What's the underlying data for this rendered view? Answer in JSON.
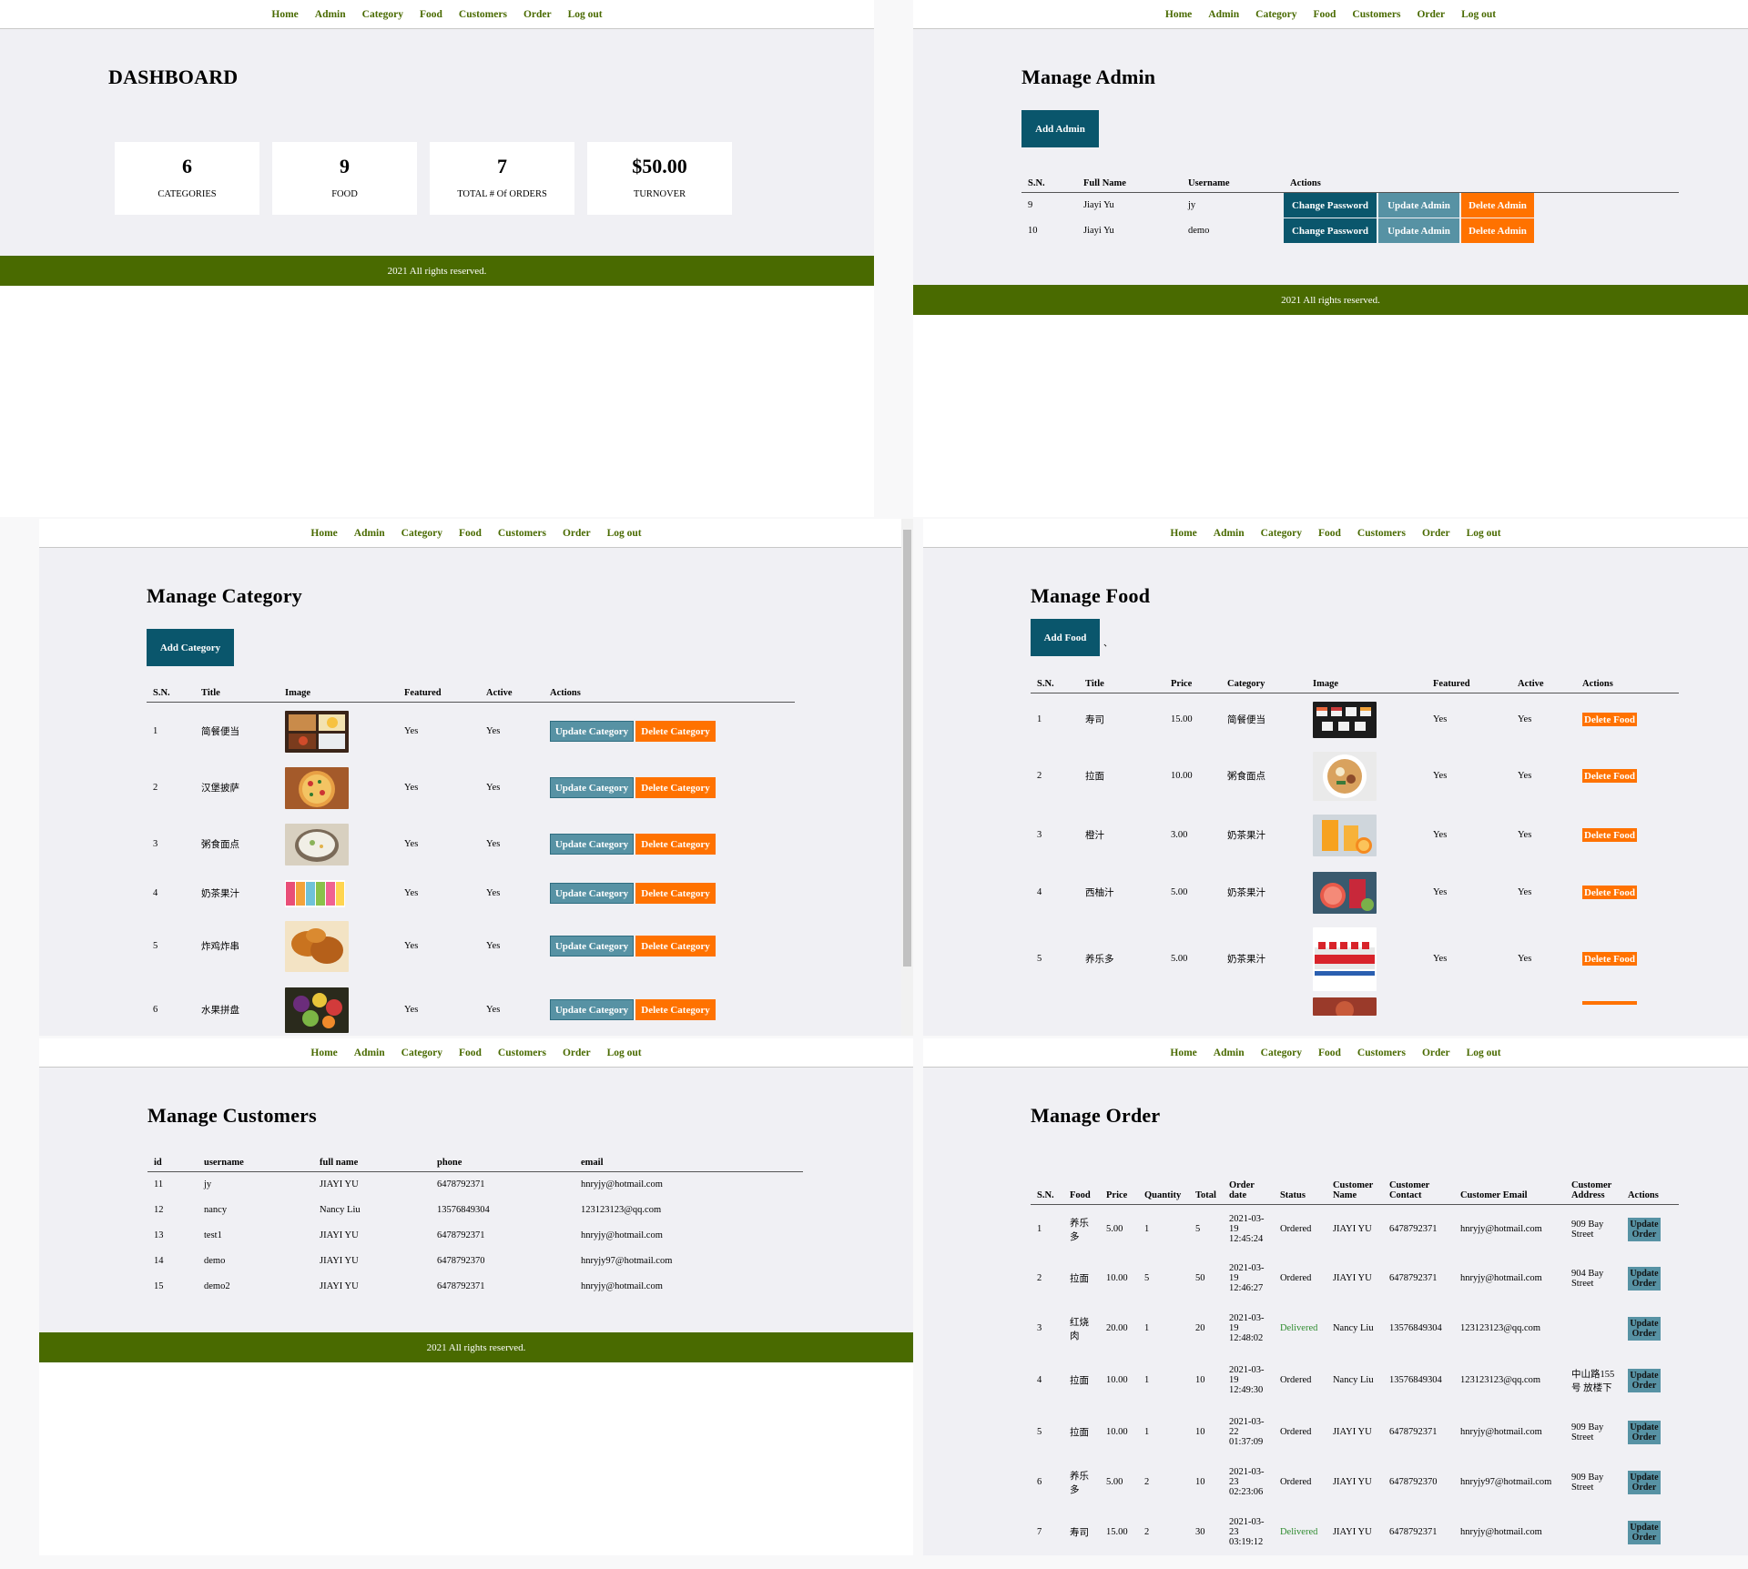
{
  "nav": [
    "Home",
    "Admin",
    "Category",
    "Food",
    "Customers",
    "Order",
    "Log out"
  ],
  "footer": "2021 All rights reserved.",
  "dashboard": {
    "title": "DASHBOARD",
    "cards": [
      {
        "value": "6",
        "label": "CATEGORIES"
      },
      {
        "value": "9",
        "label": "FOOD"
      },
      {
        "value": "7",
        "label": "TOTAL # Of ORDERS"
      },
      {
        "value": "$50.00",
        "label": "TURNOVER"
      }
    ]
  },
  "admin": {
    "title": "Manage Admin",
    "add_button": "Add Admin",
    "headers": [
      "S.N.",
      "Full Name",
      "Username",
      "Actions"
    ],
    "rows": [
      {
        "sn": "9",
        "full_name": "Jiayi Yu",
        "username": "jy"
      },
      {
        "sn": "10",
        "full_name": "Jiayi Yu",
        "username": "demo"
      }
    ],
    "change_label": "Change Password",
    "update_label": "Update Admin",
    "delete_label": "Delete Admin"
  },
  "category": {
    "title": "Manage Category",
    "add_button": "Add Category",
    "headers": [
      "S.N.",
      "Title",
      "Image",
      "Featured",
      "Active",
      "Actions"
    ],
    "rows": [
      {
        "sn": "1",
        "title": "简餐便当",
        "featured": "Yes",
        "active": "Yes"
      },
      {
        "sn": "2",
        "title": "汉堡披萨",
        "featured": "Yes",
        "active": "Yes"
      },
      {
        "sn": "3",
        "title": "粥食面点",
        "featured": "Yes",
        "active": "Yes"
      },
      {
        "sn": "4",
        "title": "奶茶果汁",
        "featured": "Yes",
        "active": "Yes"
      },
      {
        "sn": "5",
        "title": "炸鸡炸串",
        "featured": "Yes",
        "active": "Yes"
      },
      {
        "sn": "6",
        "title": "水果拼盘",
        "featured": "Yes",
        "active": "Yes"
      }
    ],
    "update_label": "Update Category",
    "delete_label": "Delete Category"
  },
  "food": {
    "title": "Manage Food",
    "add_button": "Add Food",
    "stray_mark": "、",
    "headers": [
      "S.N.",
      "Title",
      "Price",
      "Category",
      "Image",
      "Featured",
      "Active",
      "Actions"
    ],
    "rows": [
      {
        "sn": "1",
        "title": "寿司",
        "price": "15.00",
        "category": "简餐便当",
        "featured": "Yes",
        "active": "Yes"
      },
      {
        "sn": "2",
        "title": "拉面",
        "price": "10.00",
        "category": "粥食面点",
        "featured": "Yes",
        "active": "Yes"
      },
      {
        "sn": "3",
        "title": "橙汁",
        "price": "3.00",
        "category": "奶茶果汁",
        "featured": "Yes",
        "active": "Yes"
      },
      {
        "sn": "4",
        "title": "西柚汁",
        "price": "5.00",
        "category": "奶茶果汁",
        "featured": "Yes",
        "active": "Yes"
      },
      {
        "sn": "5",
        "title": "养乐多",
        "price": "5.00",
        "category": "奶茶果汁",
        "featured": "Yes",
        "active": "Yes"
      }
    ],
    "delete_label": "Delete Food"
  },
  "customers": {
    "title": "Manage Customers",
    "headers": [
      "id",
      "username",
      "full name",
      "phone",
      "email"
    ],
    "rows": [
      {
        "id": "11",
        "username": "jy",
        "full_name": "JIAYI YU",
        "phone": "6478792371",
        "email": "hnryjy@hotmail.com"
      },
      {
        "id": "12",
        "username": "nancy",
        "full_name": "Nancy Liu",
        "phone": "13576849304",
        "email": "123123123@qq.com"
      },
      {
        "id": "13",
        "username": "test1",
        "full_name": "JIAYI YU",
        "phone": "6478792371",
        "email": "hnryjy@hotmail.com"
      },
      {
        "id": "14",
        "username": "demo",
        "full_name": "JIAYI YU",
        "phone": "6478792370",
        "email": "hnryjy97@hotmail.com"
      },
      {
        "id": "15",
        "username": "demo2",
        "full_name": "JIAYI YU",
        "phone": "6478792371",
        "email": "hnryjy@hotmail.com"
      }
    ]
  },
  "orders": {
    "title": "Manage Order",
    "headers": [
      "S.N.",
      "Food",
      "Price",
      "Quantity",
      "Total",
      "Order date",
      "Status",
      "Customer Name",
      "Customer Contact",
      "Customer Email",
      "Customer Address",
      "Actions"
    ],
    "rows": [
      {
        "sn": "1",
        "food": "养乐多",
        "price": "5.00",
        "qty": "1",
        "total": "5",
        "date": "2021-03-19 12:45:24",
        "status": "Ordered",
        "name": "JIAYI YU",
        "contact": "6478792371",
        "email": "hnryjy@hotmail.com",
        "address": "909 Bay Street"
      },
      {
        "sn": "2",
        "food": "拉面",
        "price": "10.00",
        "qty": "5",
        "total": "50",
        "date": "2021-03-19 12:46:27",
        "status": "Ordered",
        "name": "JIAYI YU",
        "contact": "6478792371",
        "email": "hnryjy@hotmail.com",
        "address": "904 Bay Street"
      },
      {
        "sn": "3",
        "food": "红烧肉",
        "price": "20.00",
        "qty": "1",
        "total": "20",
        "date": "2021-03-19 12:48:02",
        "status": "Delivered",
        "name": "Nancy Liu",
        "contact": "13576849304",
        "email": "123123123@qq.com",
        "address": ""
      },
      {
        "sn": "4",
        "food": "拉面",
        "price": "10.00",
        "qty": "1",
        "total": "10",
        "date": "2021-03-19 12:49:30",
        "status": "Ordered",
        "name": "Nancy Liu",
        "contact": "13576849304",
        "email": "123123123@qq.com",
        "address": "中山路155号 放楼下"
      },
      {
        "sn": "5",
        "food": "拉面",
        "price": "10.00",
        "qty": "1",
        "total": "10",
        "date": "2021-03-22 01:37:09",
        "status": "Ordered",
        "name": "JIAYI YU",
        "contact": "6478792371",
        "email": "hnryjy@hotmail.com",
        "address": "909 Bay Street"
      },
      {
        "sn": "6",
        "food": "养乐多",
        "price": "5.00",
        "qty": "2",
        "total": "10",
        "date": "2021-03-23 02:23:06",
        "status": "Ordered",
        "name": "JIAYI YU",
        "contact": "6478792370",
        "email": "hnryjy97@hotmail.com",
        "address": "909 Bay Street"
      },
      {
        "sn": "7",
        "food": "寿司",
        "price": "15.00",
        "qty": "2",
        "total": "30",
        "date": "2021-03-23 03:19:12",
        "status": "Delivered",
        "name": "JIAYI YU",
        "contact": "6478792371",
        "email": "hnryjy@hotmail.com",
        "address": ""
      }
    ],
    "update_label": "Update Order"
  },
  "colors": {
    "nav_link": "#496a00",
    "footer": "#496a00",
    "primary": "#0a566c",
    "update": "#5792a4",
    "delete": "#ff7200",
    "content_bg": "#f0f0f4"
  }
}
